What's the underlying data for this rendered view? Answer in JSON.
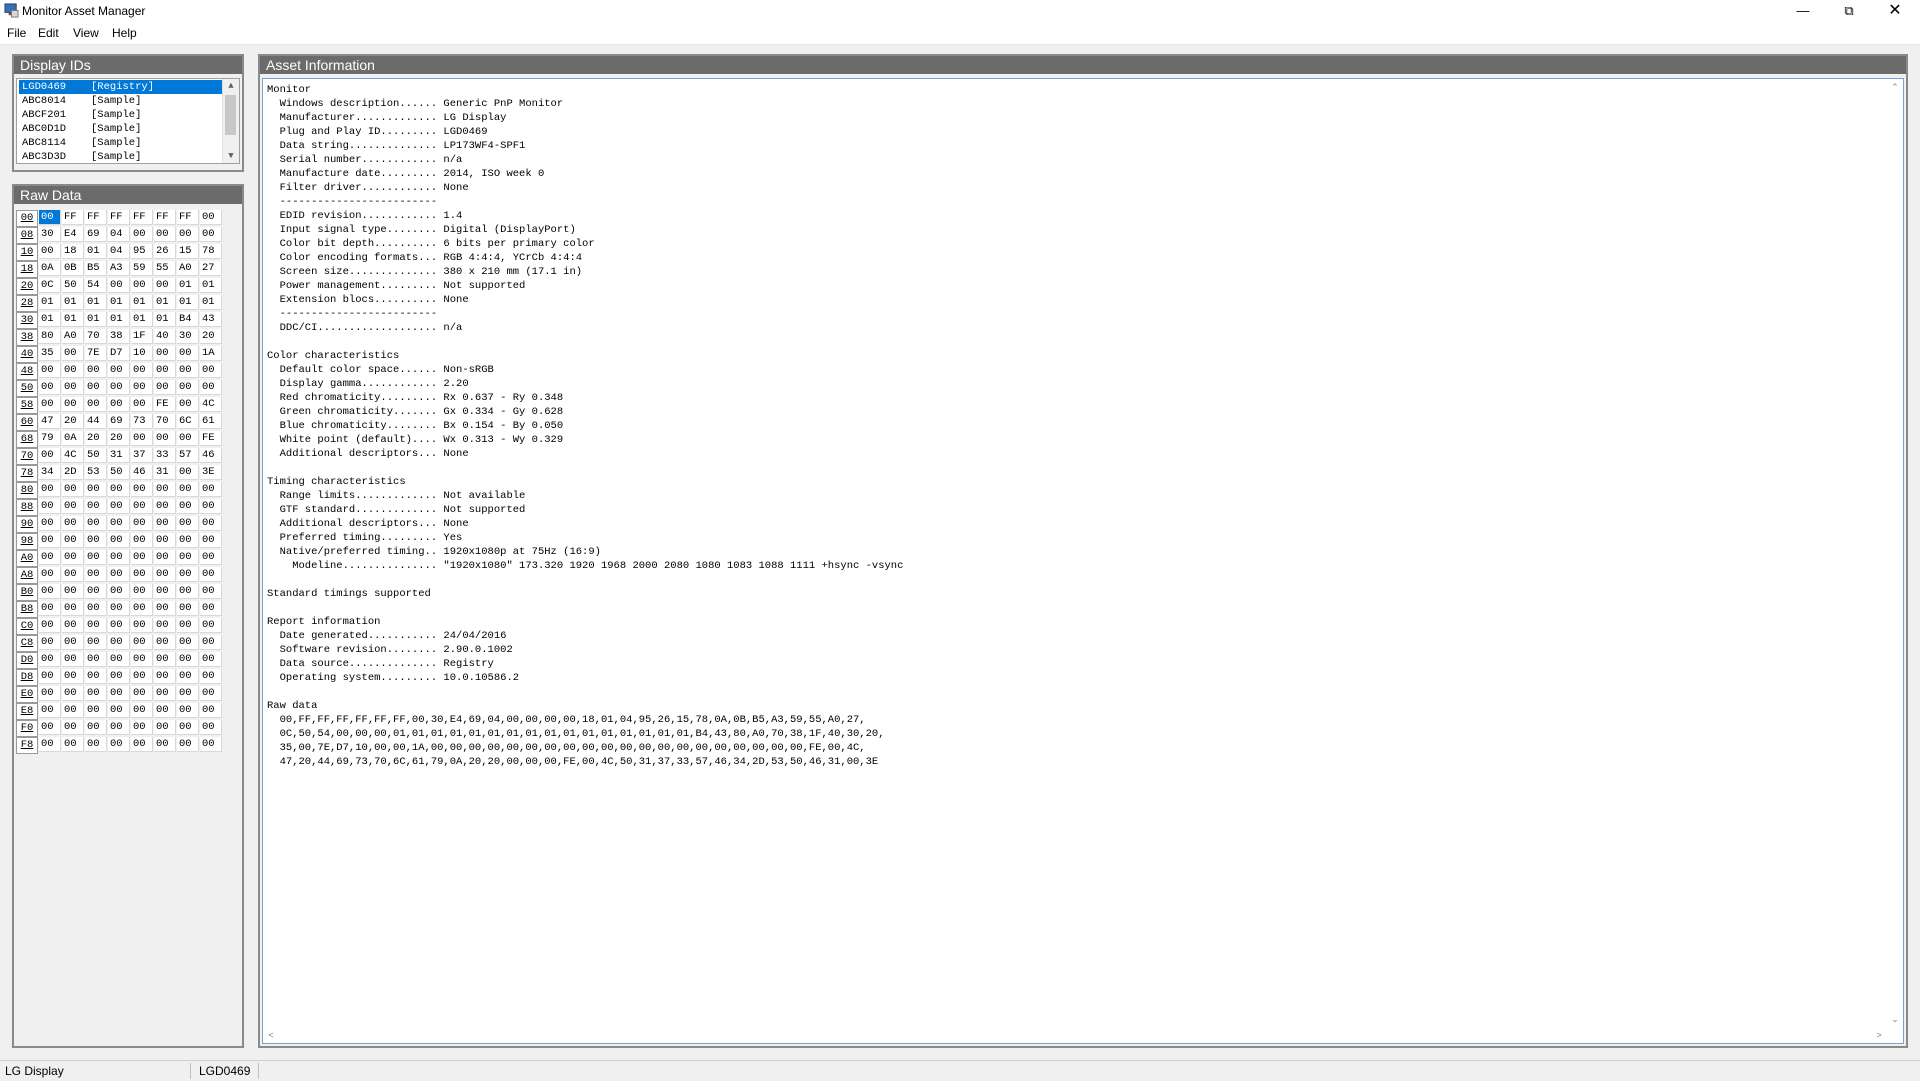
{
  "window": {
    "title": "Monitor Asset Manager",
    "minimize": "—",
    "maximize": "⧉",
    "close": "✕"
  },
  "menu": [
    "File",
    "Edit",
    "View",
    "Help"
  ],
  "display_ids": {
    "header": "Display IDs",
    "items": [
      {
        "code": "LGD0469",
        "source": "[Registry]",
        "selected": true
      },
      {
        "code": "ABC8014",
        "source": "[Sample]"
      },
      {
        "code": "ABCF201",
        "source": "[Sample]"
      },
      {
        "code": "ABC0D1D",
        "source": "[Sample]"
      },
      {
        "code": "ABC8114",
        "source": "[Sample]"
      },
      {
        "code": "ABC3D3D",
        "source": "[Sample]"
      }
    ]
  },
  "raw_data": {
    "header": "Raw Data",
    "rows": [
      {
        "addr": "00",
        "bytes": [
          "00",
          "FF",
          "FF",
          "FF",
          "FF",
          "FF",
          "FF",
          "00"
        ]
      },
      {
        "addr": "08",
        "bytes": [
          "30",
          "E4",
          "69",
          "04",
          "00",
          "00",
          "00",
          "00"
        ]
      },
      {
        "addr": "10",
        "bytes": [
          "00",
          "18",
          "01",
          "04",
          "95",
          "26",
          "15",
          "78"
        ]
      },
      {
        "addr": "18",
        "bytes": [
          "0A",
          "0B",
          "B5",
          "A3",
          "59",
          "55",
          "A0",
          "27"
        ]
      },
      {
        "addr": "20",
        "bytes": [
          "0C",
          "50",
          "54",
          "00",
          "00",
          "00",
          "01",
          "01"
        ]
      },
      {
        "addr": "28",
        "bytes": [
          "01",
          "01",
          "01",
          "01",
          "01",
          "01",
          "01",
          "01"
        ]
      },
      {
        "addr": "30",
        "bytes": [
          "01",
          "01",
          "01",
          "01",
          "01",
          "01",
          "B4",
          "43"
        ]
      },
      {
        "addr": "38",
        "bytes": [
          "80",
          "A0",
          "70",
          "38",
          "1F",
          "40",
          "30",
          "20"
        ]
      },
      {
        "addr": "40",
        "bytes": [
          "35",
          "00",
          "7E",
          "D7",
          "10",
          "00",
          "00",
          "1A"
        ]
      },
      {
        "addr": "48",
        "bytes": [
          "00",
          "00",
          "00",
          "00",
          "00",
          "00",
          "00",
          "00"
        ]
      },
      {
        "addr": "50",
        "bytes": [
          "00",
          "00",
          "00",
          "00",
          "00",
          "00",
          "00",
          "00"
        ]
      },
      {
        "addr": "58",
        "bytes": [
          "00",
          "00",
          "00",
          "00",
          "00",
          "FE",
          "00",
          "4C"
        ]
      },
      {
        "addr": "60",
        "bytes": [
          "47",
          "20",
          "44",
          "69",
          "73",
          "70",
          "6C",
          "61"
        ]
      },
      {
        "addr": "68",
        "bytes": [
          "79",
          "0A",
          "20",
          "20",
          "00",
          "00",
          "00",
          "FE"
        ]
      },
      {
        "addr": "70",
        "bytes": [
          "00",
          "4C",
          "50",
          "31",
          "37",
          "33",
          "57",
          "46"
        ]
      },
      {
        "addr": "78",
        "bytes": [
          "34",
          "2D",
          "53",
          "50",
          "46",
          "31",
          "00",
          "3E"
        ]
      },
      {
        "addr": "80",
        "bytes": [
          "00",
          "00",
          "00",
          "00",
          "00",
          "00",
          "00",
          "00"
        ]
      },
      {
        "addr": "88",
        "bytes": [
          "00",
          "00",
          "00",
          "00",
          "00",
          "00",
          "00",
          "00"
        ]
      },
      {
        "addr": "90",
        "bytes": [
          "00",
          "00",
          "00",
          "00",
          "00",
          "00",
          "00",
          "00"
        ]
      },
      {
        "addr": "98",
        "bytes": [
          "00",
          "00",
          "00",
          "00",
          "00",
          "00",
          "00",
          "00"
        ]
      },
      {
        "addr": "A0",
        "bytes": [
          "00",
          "00",
          "00",
          "00",
          "00",
          "00",
          "00",
          "00"
        ]
      },
      {
        "addr": "A8",
        "bytes": [
          "00",
          "00",
          "00",
          "00",
          "00",
          "00",
          "00",
          "00"
        ]
      },
      {
        "addr": "B0",
        "bytes": [
          "00",
          "00",
          "00",
          "00",
          "00",
          "00",
          "00",
          "00"
        ]
      },
      {
        "addr": "B8",
        "bytes": [
          "00",
          "00",
          "00",
          "00",
          "00",
          "00",
          "00",
          "00"
        ]
      },
      {
        "addr": "C0",
        "bytes": [
          "00",
          "00",
          "00",
          "00",
          "00",
          "00",
          "00",
          "00"
        ]
      },
      {
        "addr": "C8",
        "bytes": [
          "00",
          "00",
          "00",
          "00",
          "00",
          "00",
          "00",
          "00"
        ]
      },
      {
        "addr": "D0",
        "bytes": [
          "00",
          "00",
          "00",
          "00",
          "00",
          "00",
          "00",
          "00"
        ]
      },
      {
        "addr": "D8",
        "bytes": [
          "00",
          "00",
          "00",
          "00",
          "00",
          "00",
          "00",
          "00"
        ]
      },
      {
        "addr": "E0",
        "bytes": [
          "00",
          "00",
          "00",
          "00",
          "00",
          "00",
          "00",
          "00"
        ]
      },
      {
        "addr": "E8",
        "bytes": [
          "00",
          "00",
          "00",
          "00",
          "00",
          "00",
          "00",
          "00"
        ]
      },
      {
        "addr": "F0",
        "bytes": [
          "00",
          "00",
          "00",
          "00",
          "00",
          "00",
          "00",
          "00"
        ]
      },
      {
        "addr": "F8",
        "bytes": [
          "00",
          "00",
          "00",
          "00",
          "00",
          "00",
          "00",
          "00"
        ]
      }
    ]
  },
  "asset_info": {
    "header": "Asset Information",
    "text": "Monitor\n  Windows description...... Generic PnP Monitor\n  Manufacturer............. LG Display\n  Plug and Play ID......... LGD0469\n  Data string.............. LP173WF4-SPF1\n  Serial number............ n/a\n  Manufacture date......... 2014, ISO week 0\n  Filter driver............ None\n  -------------------------\n  EDID revision............ 1.4\n  Input signal type........ Digital (DisplayPort)\n  Color bit depth.......... 6 bits per primary color\n  Color encoding formats... RGB 4:4:4, YCrCb 4:4:4\n  Screen size.............. 380 x 210 mm (17.1 in)\n  Power management......... Not supported\n  Extension blocs.......... None\n  -------------------------\n  DDC/CI................... n/a\n\nColor characteristics\n  Default color space...... Non-sRGB\n  Display gamma............ 2.20\n  Red chromaticity......... Rx 0.637 - Ry 0.348\n  Green chromaticity....... Gx 0.334 - Gy 0.628\n  Blue chromaticity........ Bx 0.154 - By 0.050\n  White point (default).... Wx 0.313 - Wy 0.329\n  Additional descriptors... None\n\nTiming characteristics\n  Range limits............. Not available\n  GTF standard............. Not supported\n  Additional descriptors... None\n  Preferred timing......... Yes\n  Native/preferred timing.. 1920x1080p at 75Hz (16:9)\n    Modeline............... \"1920x1080\" 173.320 1920 1968 2000 2080 1080 1083 1088 1111 +hsync -vsync\n\nStandard timings supported\n\nReport information\n  Date generated........... 24/04/2016\n  Software revision........ 2.90.0.1002\n  Data source.............. Registry\n  Operating system......... 10.0.10586.2\n\nRaw data\n  00,FF,FF,FF,FF,FF,FF,00,30,E4,69,04,00,00,00,00,18,01,04,95,26,15,78,0A,0B,B5,A3,59,55,A0,27,\n  0C,50,54,00,00,00,01,01,01,01,01,01,01,01,01,01,01,01,01,01,01,01,B4,43,80,A0,70,38,1F,40,30,20,\n  35,00,7E,D7,10,00,00,1A,00,00,00,00,00,00,00,00,00,00,00,00,00,00,00,00,00,00,00,00,FE,00,4C,\n  47,20,44,69,73,70,6C,61,79,0A,20,20,00,00,00,FE,00,4C,50,31,37,33,57,46,34,2D,53,50,46,31,00,3E"
  },
  "status": {
    "manufacturer": "LG Display",
    "id": "LGD0469"
  }
}
